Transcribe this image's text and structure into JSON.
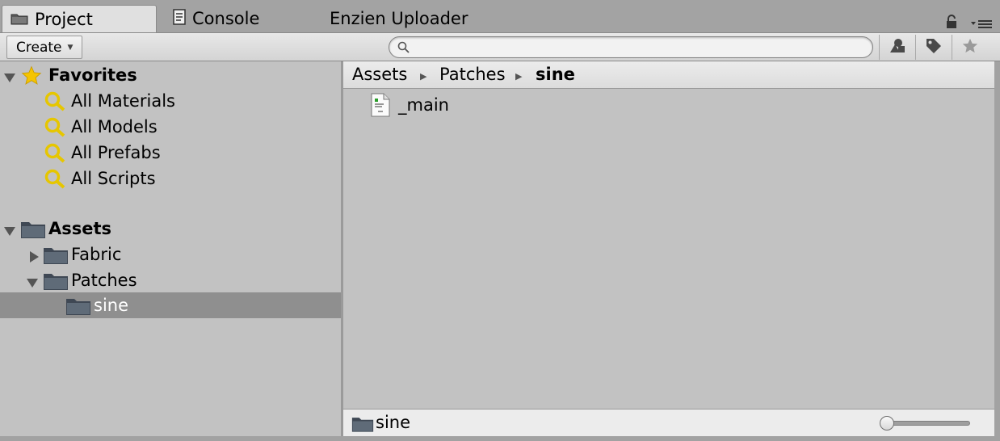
{
  "tabs": [
    {
      "label": "Project",
      "icon": "folder-icon",
      "active": true
    },
    {
      "label": "Console",
      "icon": "console-icon",
      "active": false
    },
    {
      "label": "Enzien Uploader",
      "active": false
    }
  ],
  "toolbar": {
    "create_label": "Create",
    "search_placeholder": "",
    "buttons": [
      "filter-by-type-icon",
      "filter-by-label-icon",
      "favorite-star-icon"
    ]
  },
  "tree": {
    "favorites_label": "Favorites",
    "favorites": [
      "All Materials",
      "All Models",
      "All Prefabs",
      "All Scripts"
    ],
    "assets_label": "Assets",
    "assets_children": [
      {
        "label": "Fabric",
        "expanded": false
      },
      {
        "label": "Patches",
        "expanded": true
      }
    ],
    "selected_label": "sine"
  },
  "breadcrumb": [
    "Assets",
    "Patches",
    "sine"
  ],
  "files": [
    {
      "name": "_main",
      "icon": "text-asset-icon"
    }
  ],
  "footer": {
    "path_label": "sine",
    "zoom_value": 0.0
  },
  "colors": {
    "panel_bg": "#c2c2c2",
    "selected_bg": "#8f8f8f",
    "folder": "#4b5563",
    "star": "#f5c400",
    "magnifier": "#e6c600"
  }
}
